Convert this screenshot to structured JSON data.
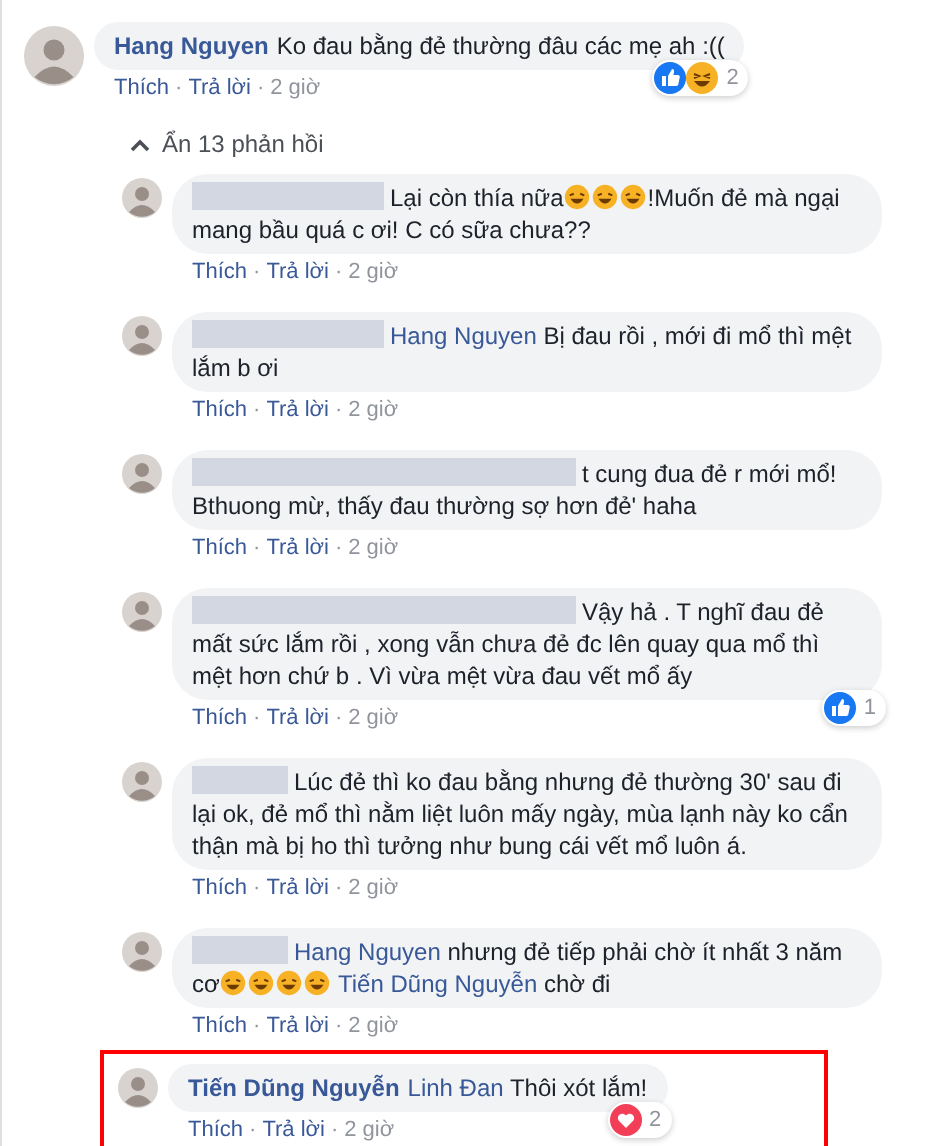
{
  "comment": {
    "author": "Hang Nguyen",
    "segments": [
      {
        "kind": "text",
        "text": "Ko đau bằng đẻ thường đâu các mẹ ah :(("
      }
    ],
    "reactions": {
      "icons": [
        {
          "kind": "like"
        },
        {
          "kind": "haha"
        }
      ],
      "count": "2"
    },
    "meta": [
      {
        "kind": "link",
        "text": "Thích"
      },
      {
        "kind": "dot",
        "text": "·"
      },
      {
        "kind": "link",
        "text": "Trả lời"
      },
      {
        "kind": "dot",
        "text": "·"
      },
      {
        "kind": "time",
        "text": "2 giờ"
      }
    ]
  },
  "replies_toggle": {
    "label": "Ẩn 13 phản hồi",
    "expanded": true
  },
  "replies": [
    {
      "segments": [
        {
          "kind": "redacted"
        },
        {
          "kind": "redacted"
        },
        {
          "kind": "text",
          "text": "Lại còn thía nữa"
        },
        {
          "kind": "emoji"
        },
        {
          "kind": "emoji"
        },
        {
          "kind": "emoji"
        },
        {
          "kind": "text",
          "text": "!Muốn đẻ mà ngại mang bầu quá c ơi! C có sữa chưa??"
        }
      ],
      "meta": [
        {
          "kind": "link",
          "text": "Thích"
        },
        {
          "kind": "dot",
          "text": "·"
        },
        {
          "kind": "link",
          "text": "Trả lời"
        },
        {
          "kind": "dot",
          "text": "·"
        },
        {
          "kind": "time",
          "text": "2 giờ"
        }
      ],
      "highlighted": false
    },
    {
      "segments": [
        {
          "kind": "redacted"
        },
        {
          "kind": "redacted"
        },
        {
          "kind": "mention",
          "text": "Hang Nguyen"
        },
        {
          "kind": "text",
          "text": "Bị đau rồi , mới đi mổ thì mệt lắm b ơi"
        }
      ],
      "meta": [
        {
          "kind": "link",
          "text": "Thích"
        },
        {
          "kind": "dot",
          "text": "·"
        },
        {
          "kind": "link",
          "text": "Trả lời"
        },
        {
          "kind": "dot",
          "text": "·"
        },
        {
          "kind": "time",
          "text": "2 giờ"
        }
      ],
      "highlighted": false
    },
    {
      "segments": [
        {
          "kind": "redacted"
        },
        {
          "kind": "redacted"
        },
        {
          "kind": "redacted"
        },
        {
          "kind": "redacted"
        },
        {
          "kind": "text",
          "text": "t cung đua đẻ r mới mổ! Bthuong mừ, thấy đau thường sợ hơn đẻ' haha"
        }
      ],
      "meta": [
        {
          "kind": "link",
          "text": "Thích"
        },
        {
          "kind": "dot",
          "text": "·"
        },
        {
          "kind": "link",
          "text": "Trả lời"
        },
        {
          "kind": "dot",
          "text": "·"
        },
        {
          "kind": "time",
          "text": "2 giờ"
        }
      ],
      "highlighted": false
    },
    {
      "segments": [
        {
          "kind": "redacted"
        },
        {
          "kind": "redacted"
        },
        {
          "kind": "redacted"
        },
        {
          "kind": "redacted"
        },
        {
          "kind": "text",
          "text": "Vậy hả . T nghĩ đau đẻ mất sức lắm rồi , xong vẫn chưa đẻ đc lên quay qua mổ thì mệt hơn chứ b . Vì vừa mệt vừa đau vết mổ ấy"
        }
      ],
      "reactions": {
        "icons": [
          {
            "kind": "like"
          }
        ],
        "count": "1"
      },
      "meta": [
        {
          "kind": "link",
          "text": "Thích"
        },
        {
          "kind": "dot",
          "text": "·"
        },
        {
          "kind": "link",
          "text": "Trả lời"
        },
        {
          "kind": "dot",
          "text": "·"
        },
        {
          "kind": "time",
          "text": "2 giờ"
        }
      ],
      "highlighted": false
    },
    {
      "segments": [
        {
          "kind": "redacted"
        },
        {
          "kind": "text",
          "text": "Lúc đẻ thì ko đau bằng nhưng đẻ thường 30' sau đi lại ok, đẻ mổ thì nằm liệt luôn mấy ngày, mùa lạnh này ko cẩn thận mà bị ho thì tưởng như bung cái vết mổ luôn á."
        }
      ],
      "meta": [
        {
          "kind": "link",
          "text": "Thích"
        },
        {
          "kind": "dot",
          "text": "·"
        },
        {
          "kind": "link",
          "text": "Trả lời"
        },
        {
          "kind": "dot",
          "text": "·"
        },
        {
          "kind": "time",
          "text": "2 giờ"
        }
      ],
      "highlighted": false
    },
    {
      "segments": [
        {
          "kind": "redacted"
        },
        {
          "kind": "mention",
          "text": "Hang Nguyen"
        },
        {
          "kind": "text",
          "text": "nhưng đẻ tiếp phải chờ ít nhất 3 năm cơ"
        },
        {
          "kind": "emoji"
        },
        {
          "kind": "emoji"
        },
        {
          "kind": "emoji"
        },
        {
          "kind": "emoji"
        },
        {
          "kind": "mention",
          "text": "Tiến Dũng Nguyễn"
        },
        {
          "kind": "text",
          "text": "chờ đi"
        }
      ],
      "meta": [
        {
          "kind": "link",
          "text": "Thích"
        },
        {
          "kind": "dot",
          "text": "·"
        },
        {
          "kind": "link",
          "text": "Trả lời"
        },
        {
          "kind": "dot",
          "text": "·"
        },
        {
          "kind": "time",
          "text": "2 giờ"
        }
      ],
      "highlighted": false
    },
    {
      "author": "Tiến Dũng Nguyễn",
      "segments": [
        {
          "kind": "mention",
          "text": "Linh Đan"
        },
        {
          "kind": "text",
          "text": "Thôi xót lắm!"
        }
      ],
      "reactions": {
        "icons": [
          {
            "kind": "love"
          }
        ],
        "count": "2"
      },
      "meta": [
        {
          "kind": "link",
          "text": "Thích"
        },
        {
          "kind": "dot",
          "text": "·"
        },
        {
          "kind": "link",
          "text": "Trả lời"
        },
        {
          "kind": "dot",
          "text": "·"
        },
        {
          "kind": "time",
          "text": "2 giờ"
        }
      ],
      "highlighted": true
    }
  ]
}
